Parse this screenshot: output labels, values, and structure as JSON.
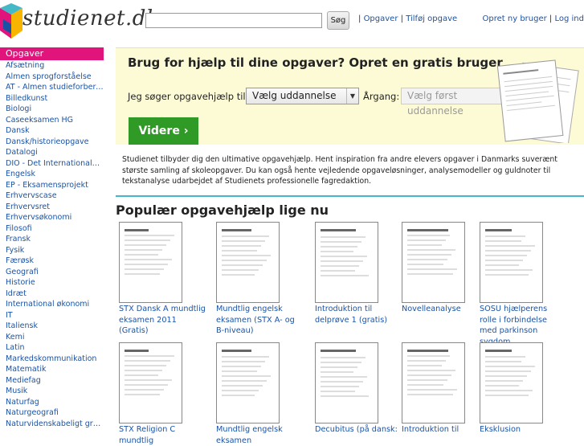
{
  "header": {
    "logo_text": "studienet.dk",
    "search_placeholder": "",
    "search_button": "Søg",
    "link_sep1": "|",
    "link_opgaver": "Opgaver",
    "link_sep2": "|",
    "link_tilfoej": "Tilføj opgave",
    "link_opret": "Opret ny bruger",
    "link_sep3": "|",
    "link_login": "Log ind"
  },
  "sidebar": {
    "title": "Opgaver",
    "items": [
      "Afsætning",
      "Almen sprogforståelse",
      "AT - Almen studieforbere...",
      "Billedkunst",
      "Biologi",
      "Caseeksamen HG",
      "Dansk",
      "Dansk/historieopgave",
      "Datalogi",
      "DIO - Det Internationale...",
      "Engelsk",
      "EP - Eksamensprojekt",
      "Erhvervscase",
      "Erhvervsret",
      "Erhvervsøkonomi",
      "Filosofi",
      "Fransk",
      "Fysik",
      "Færøsk",
      "Geografi",
      "Historie",
      "Idræt",
      "International økonomi",
      "IT",
      "Italiensk",
      "Kemi",
      "Latin",
      "Markedskommunikation",
      "Matematik",
      "Mediefag",
      "Musik",
      "Naturfag",
      "Naturgeografi",
      "Naturvidenskabeligt grun..."
    ]
  },
  "promo": {
    "title": "Brug for hjælp til dine opgaver? Opret en gratis bruger",
    "label": "Jeg søger opgavehjælp til:",
    "select_education": "Vælg uddannelse",
    "year_label": "Årgang:",
    "select_year": "Vælg først uddannelse",
    "button": "Videre ›"
  },
  "intro": "Studienet tilbyder dig den ultimative opgavehjælp. Hent inspiration fra andre elevers opgaver i Danmarks suverænt største samling af skoleopgaver. Du kan også hente vejledende opgaveløsninger, analysemodeller og guldnoter til tekstanalyse udarbejdet af Studienets professionelle fagredaktion.",
  "popular": {
    "title": "Populær opgavehjælp lige nu",
    "row1": [
      "STX Dansk A mundtlig eksamen 2011 (Gratis)",
      "Mundtlig engelsk eksamen (STX A- og B-niveau)",
      "Introduktion til delprøve 1 (gratis)",
      "Novelleanalyse",
      "SOSU hjælperens rolle i forbindelse med parkinson sygdom"
    ],
    "row2": [
      "STX Religion C mundtlig",
      "Mundtlig engelsk eksamen",
      "Decubitus (på dansk:",
      "Introduktion til",
      "Eksklusion"
    ]
  },
  "colors": {
    "accent_pink": "#e0147a",
    "button_green": "#2f9a26",
    "divider_teal": "#45b8c8",
    "link_blue": "#1a53a6",
    "promo_bg": "#fdfbd6"
  }
}
